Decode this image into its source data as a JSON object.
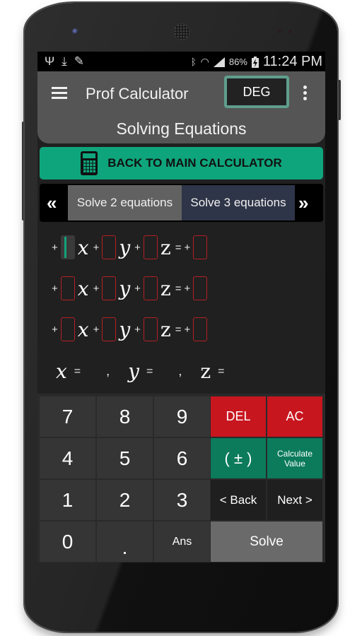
{
  "status_bar": {
    "left_icons": [
      "usb-icon",
      "download-icon",
      "edit-icon"
    ],
    "right_icons": [
      "bluetooth-icon",
      "wifi-icon",
      "signal-icon",
      "battery-charging-icon"
    ],
    "battery": "86%",
    "time": "11:24 PM"
  },
  "app_bar": {
    "title": "Prof Calculator",
    "mode_button": "DEG",
    "subtitle": "Solving Equations"
  },
  "back_button": {
    "label": "BACK TO MAIN CALCULATOR",
    "icon": "calculator-icon",
    "color": "#0fa57c"
  },
  "tabs": {
    "prev": "«",
    "next": "»",
    "items": [
      {
        "label": "Solve 2 equations",
        "selected": false
      },
      {
        "label": "Solve 3 equations",
        "selected": true
      }
    ]
  },
  "equations": {
    "plus": "+",
    "equals": "=",
    "vars": [
      "x",
      "y",
      "z"
    ],
    "rows": [
      {
        "coeffs": [
          "",
          "",
          ""
        ],
        "rhs": "",
        "active_field": 0
      },
      {
        "coeffs": [
          "",
          "",
          ""
        ],
        "rhs": ""
      },
      {
        "coeffs": [
          "",
          "",
          ""
        ],
        "rhs": ""
      }
    ],
    "result": {
      "x": "",
      "y": "",
      "z": "",
      "separator": ","
    }
  },
  "keypad": {
    "rows": [
      [
        "7",
        "8",
        "9",
        "DEL",
        "AC"
      ],
      [
        "4",
        "5",
        "6",
        "( ± )",
        "Calculate Value"
      ],
      [
        "1",
        "2",
        "3",
        "< Back",
        "Next >"
      ],
      [
        "0",
        ".",
        "Ans",
        "Solve"
      ]
    ],
    "colors": {
      "red": "#c8161f",
      "green": "#0b7b5c",
      "number": "#353535",
      "solve": "#6a6a6a"
    }
  }
}
